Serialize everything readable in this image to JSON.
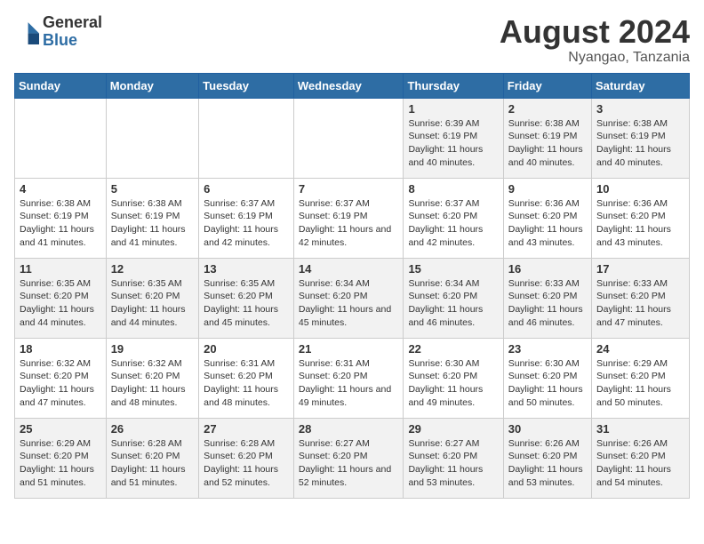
{
  "header": {
    "logo_general": "General",
    "logo_blue": "Blue",
    "month_title": "August 2024",
    "location": "Nyangao, Tanzania"
  },
  "weekdays": [
    "Sunday",
    "Monday",
    "Tuesday",
    "Wednesday",
    "Thursday",
    "Friday",
    "Saturday"
  ],
  "weeks": [
    [
      {
        "day": "",
        "content": ""
      },
      {
        "day": "",
        "content": ""
      },
      {
        "day": "",
        "content": ""
      },
      {
        "day": "",
        "content": ""
      },
      {
        "day": "1",
        "content": "Sunrise: 6:39 AM\nSunset: 6:19 PM\nDaylight: 11 hours and 40 minutes."
      },
      {
        "day": "2",
        "content": "Sunrise: 6:38 AM\nSunset: 6:19 PM\nDaylight: 11 hours and 40 minutes."
      },
      {
        "day": "3",
        "content": "Sunrise: 6:38 AM\nSunset: 6:19 PM\nDaylight: 11 hours and 40 minutes."
      }
    ],
    [
      {
        "day": "4",
        "content": "Sunrise: 6:38 AM\nSunset: 6:19 PM\nDaylight: 11 hours and 41 minutes."
      },
      {
        "day": "5",
        "content": "Sunrise: 6:38 AM\nSunset: 6:19 PM\nDaylight: 11 hours and 41 minutes."
      },
      {
        "day": "6",
        "content": "Sunrise: 6:37 AM\nSunset: 6:19 PM\nDaylight: 11 hours and 42 minutes."
      },
      {
        "day": "7",
        "content": "Sunrise: 6:37 AM\nSunset: 6:19 PM\nDaylight: 11 hours and 42 minutes."
      },
      {
        "day": "8",
        "content": "Sunrise: 6:37 AM\nSunset: 6:20 PM\nDaylight: 11 hours and 42 minutes."
      },
      {
        "day": "9",
        "content": "Sunrise: 6:36 AM\nSunset: 6:20 PM\nDaylight: 11 hours and 43 minutes."
      },
      {
        "day": "10",
        "content": "Sunrise: 6:36 AM\nSunset: 6:20 PM\nDaylight: 11 hours and 43 minutes."
      }
    ],
    [
      {
        "day": "11",
        "content": "Sunrise: 6:35 AM\nSunset: 6:20 PM\nDaylight: 11 hours and 44 minutes."
      },
      {
        "day": "12",
        "content": "Sunrise: 6:35 AM\nSunset: 6:20 PM\nDaylight: 11 hours and 44 minutes."
      },
      {
        "day": "13",
        "content": "Sunrise: 6:35 AM\nSunset: 6:20 PM\nDaylight: 11 hours and 45 minutes."
      },
      {
        "day": "14",
        "content": "Sunrise: 6:34 AM\nSunset: 6:20 PM\nDaylight: 11 hours and 45 minutes."
      },
      {
        "day": "15",
        "content": "Sunrise: 6:34 AM\nSunset: 6:20 PM\nDaylight: 11 hours and 46 minutes."
      },
      {
        "day": "16",
        "content": "Sunrise: 6:33 AM\nSunset: 6:20 PM\nDaylight: 11 hours and 46 minutes."
      },
      {
        "day": "17",
        "content": "Sunrise: 6:33 AM\nSunset: 6:20 PM\nDaylight: 11 hours and 47 minutes."
      }
    ],
    [
      {
        "day": "18",
        "content": "Sunrise: 6:32 AM\nSunset: 6:20 PM\nDaylight: 11 hours and 47 minutes."
      },
      {
        "day": "19",
        "content": "Sunrise: 6:32 AM\nSunset: 6:20 PM\nDaylight: 11 hours and 48 minutes."
      },
      {
        "day": "20",
        "content": "Sunrise: 6:31 AM\nSunset: 6:20 PM\nDaylight: 11 hours and 48 minutes."
      },
      {
        "day": "21",
        "content": "Sunrise: 6:31 AM\nSunset: 6:20 PM\nDaylight: 11 hours and 49 minutes."
      },
      {
        "day": "22",
        "content": "Sunrise: 6:30 AM\nSunset: 6:20 PM\nDaylight: 11 hours and 49 minutes."
      },
      {
        "day": "23",
        "content": "Sunrise: 6:30 AM\nSunset: 6:20 PM\nDaylight: 11 hours and 50 minutes."
      },
      {
        "day": "24",
        "content": "Sunrise: 6:29 AM\nSunset: 6:20 PM\nDaylight: 11 hours and 50 minutes."
      }
    ],
    [
      {
        "day": "25",
        "content": "Sunrise: 6:29 AM\nSunset: 6:20 PM\nDaylight: 11 hours and 51 minutes."
      },
      {
        "day": "26",
        "content": "Sunrise: 6:28 AM\nSunset: 6:20 PM\nDaylight: 11 hours and 51 minutes."
      },
      {
        "day": "27",
        "content": "Sunrise: 6:28 AM\nSunset: 6:20 PM\nDaylight: 11 hours and 52 minutes."
      },
      {
        "day": "28",
        "content": "Sunrise: 6:27 AM\nSunset: 6:20 PM\nDaylight: 11 hours and 52 minutes."
      },
      {
        "day": "29",
        "content": "Sunrise: 6:27 AM\nSunset: 6:20 PM\nDaylight: 11 hours and 53 minutes."
      },
      {
        "day": "30",
        "content": "Sunrise: 6:26 AM\nSunset: 6:20 PM\nDaylight: 11 hours and 53 minutes."
      },
      {
        "day": "31",
        "content": "Sunrise: 6:26 AM\nSunset: 6:20 PM\nDaylight: 11 hours and 54 minutes."
      }
    ]
  ]
}
